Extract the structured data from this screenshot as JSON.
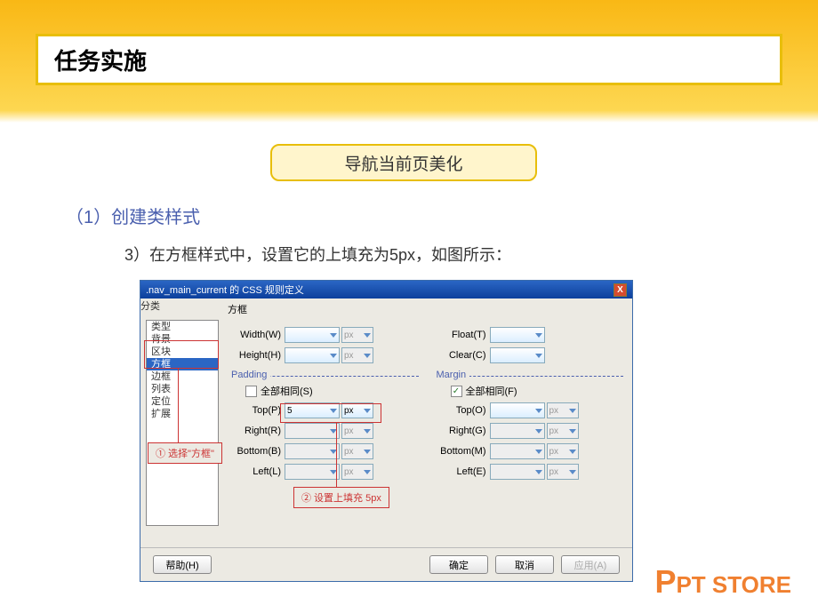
{
  "slide": {
    "title": "任务实施",
    "tag": "导航当前页美化",
    "heading1": "（1）创建类样式",
    "heading2": "3）在方框样式中，设置它的上填充为5px，如图所示："
  },
  "dialog": {
    "title": ".nav_main_current 的 CSS 规则定义",
    "sidebar_label": "分类",
    "panel_title": "方框",
    "categories": [
      "类型",
      "背景",
      "区块",
      "方框",
      "边框",
      "列表",
      "定位",
      "扩展"
    ],
    "fields": {
      "width": "Width(W)",
      "height": "Height(H)",
      "float": "Float(T)",
      "clear": "Clear(C)",
      "padding": "Padding",
      "margin": "Margin",
      "same1": "全部相同(S)",
      "same2": "全部相同(F)",
      "top": "Top(P)",
      "right": "Right(R)",
      "bottom": "Bottom(B)",
      "left": "Left(L)",
      "top2": "Top(O)",
      "right2": "Right(G)",
      "bottom2": "Bottom(M)",
      "left2": "Left(E)",
      "unit": "px",
      "top_value": "5"
    },
    "buttons": {
      "help": "帮助(H)",
      "ok": "确定",
      "cancel": "取消",
      "apply": "应用(A)"
    }
  },
  "callouts": {
    "c1": "① 选择\"方框\"",
    "c2": "② 设置上填充 5px"
  },
  "logo": {
    "p": "P",
    "rest": "PT STORE"
  }
}
